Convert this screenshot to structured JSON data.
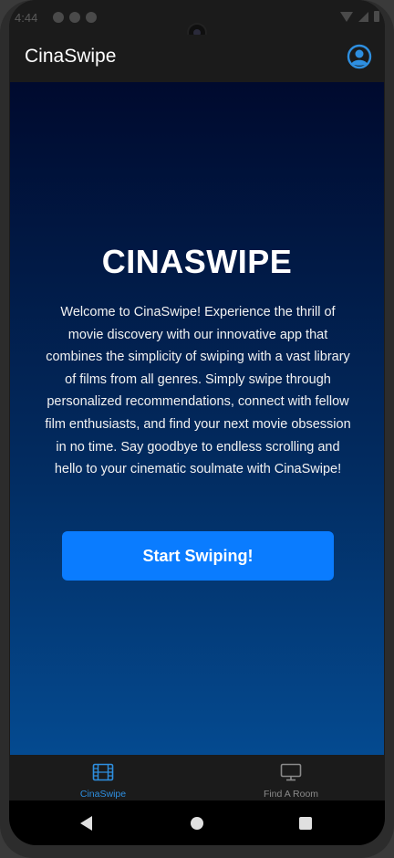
{
  "status_bar": {
    "time": "4:44"
  },
  "app_bar": {
    "title": "CinaSwipe",
    "profile_icon": "account-circle-icon"
  },
  "hero": {
    "title": "CINASWIPE",
    "description": "Welcome to CinaSwipe! Experience the thrill of movie discovery with our innovative app that combines the simplicity of swiping with a vast library of films from all genres. Simply swipe through personalized recommendations, connect with fellow film enthusiasts, and find your next movie obsession in no time. Say goodbye to endless scrolling and hello to your cinematic soulmate with CinaSwipe!",
    "cta_label": "Start Swiping!"
  },
  "tabs": [
    {
      "label": "CinaSwipe",
      "icon": "film-icon",
      "active": true
    },
    {
      "label": "Find A Room",
      "icon": "monitor-icon",
      "active": false
    }
  ],
  "colors": {
    "accent": "#0a7cff",
    "active_tab": "#2e8fe0",
    "inactive_tab": "#8a8a8a",
    "gradient_top": "#000a2e",
    "gradient_bottom": "#044a90"
  },
  "nav_bar": {
    "back_icon": "back-triangle-icon",
    "home_icon": "home-circle-icon",
    "recent_icon": "recents-square-icon"
  }
}
